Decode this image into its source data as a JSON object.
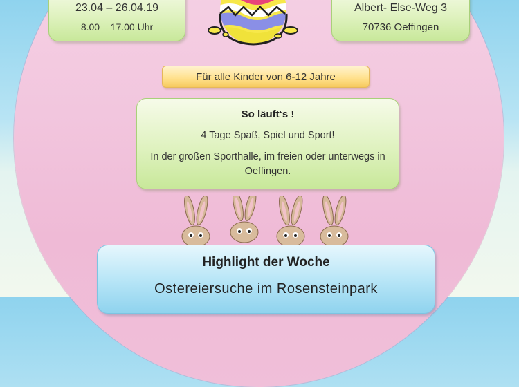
{
  "event": {
    "dates": "23.04 – 26.04.19",
    "time": "8.00 – 17.00 Uhr",
    "street": "Albert- Else-Weg 3",
    "city": "70736 Oeffingen",
    "age_banner": "Für alle Kinder von 6-12 Jahre"
  },
  "program": {
    "title": "So läuft‘s !",
    "line1": "4 Tage Spaß, Spiel und Sport!",
    "line2": "In der großen Sporthalle, im freien oder unterwegs in Oeffingen."
  },
  "highlight": {
    "title": "Highlight der Woche",
    "subtitle": "Ostereiersuche im Rosensteinpark"
  },
  "colors": {
    "egg_pink": "#f2c6de",
    "box_green": "#dff2bf",
    "banner_yellow": "#ffe08a",
    "highlight_blue": "#b9e6f7"
  },
  "icons": [
    "easter-egg-icon",
    "bunny-icon"
  ]
}
